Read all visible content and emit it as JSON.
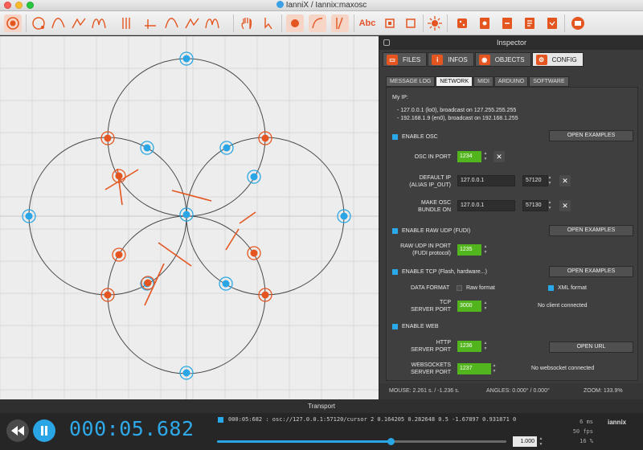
{
  "window": {
    "title": "IanniX / Iannix:maxosc"
  },
  "toolbar": {
    "tools": [
      "record-icon",
      "circle-curve-icon",
      "bezier-curve-icon",
      "bezier-curve-2-icon",
      "ellipse-curve-icon",
      "trigger-icon",
      "cursor-curve-icon",
      "curve-icon",
      "curve-2-icon",
      "curve-3-icon",
      "hand-icon",
      "cursor-tool-icon",
      "snap-icon",
      "grid-icon",
      "timeline-icon"
    ],
    "text_tool": "Abc"
  },
  "inspector": {
    "title": "Inspector",
    "tabs": [
      {
        "label": "FILES",
        "icon": "folder-icon"
      },
      {
        "label": "INFOS",
        "icon": "info-icon"
      },
      {
        "label": "OBJECTS",
        "icon": "eye-icon"
      },
      {
        "label": "CONFIG",
        "icon": "config-icon"
      }
    ],
    "subtabs": [
      "MESSAGE LOG",
      "NETWORK",
      "MIDI",
      "ARDUINO",
      "SOFTWARE"
    ],
    "network": {
      "my_ip_label": "My IP:",
      "ip_lines": [
        "- 127.0.0.1 (lo0), broadcast on 127.255.255.255",
        "- 192.168.1.9 (en0), broadcast on 192.168.1.255"
      ],
      "enable_osc": "ENABLE OSC",
      "open_examples": "OPEN EXAMPLES",
      "osc_in_port_label": "OSC IN PORT",
      "osc_in_port": "1234",
      "default_ip_label": [
        "DEFAULT IP",
        "(ALIAS IP_OUT)"
      ],
      "default_ip": "127.0.0.1",
      "default_ip_port": "57120",
      "make_osc_label": [
        "MAKE OSC",
        "BUNDLE ON"
      ],
      "bundle_ip": "127.0.0.1",
      "bundle_port": "57130",
      "enable_raw_udp": "ENABLE RAW UDP (FUDI)",
      "raw_udp_label": [
        "RAW UDP IN PORT",
        "(FUDI protocol)"
      ],
      "raw_udp_port": "1235",
      "enable_tcp": "ENABLE TCP (Flash, hardware...)",
      "data_format_label": "DATA FORMAT",
      "raw_format": "Raw format",
      "xml_format": "XML format",
      "tcp_port_label": [
        "TCP",
        "SERVER PORT"
      ],
      "tcp_port": "3000",
      "tcp_status": "No client connected",
      "enable_web": "ENABLE WEB",
      "http_label": [
        "HTTP",
        "SERVER PORT"
      ],
      "http_port": "1236",
      "open_url": "OPEN URL",
      "ws_label": [
        "WEBSOCKETS",
        "SERVER PORT"
      ],
      "ws_port": "1237",
      "ws_status": "No websocket connected"
    },
    "status": {
      "mouse": "MOUSE: 2.261 s. / -1.236 s.",
      "angles": "ANGLES: 0.000° / 0.000°",
      "zoom": "ZOOM: 133.9%"
    }
  },
  "transport": {
    "title": "Transport",
    "time": "000:05.682",
    "log": "000:05:682 : osc://127.0.0.1:57120/cursor 2  0.164205 0.282648 0.5 -1.67897 0.931871 0",
    "progress": 0.6,
    "speed": "1.000",
    "stats": [
      "6 ms",
      "50 fps",
      "16 %"
    ],
    "logo": "iannix"
  },
  "colors": {
    "accent": "#e55520",
    "blue": "#2aa6e6",
    "green": "#52b51d"
  }
}
